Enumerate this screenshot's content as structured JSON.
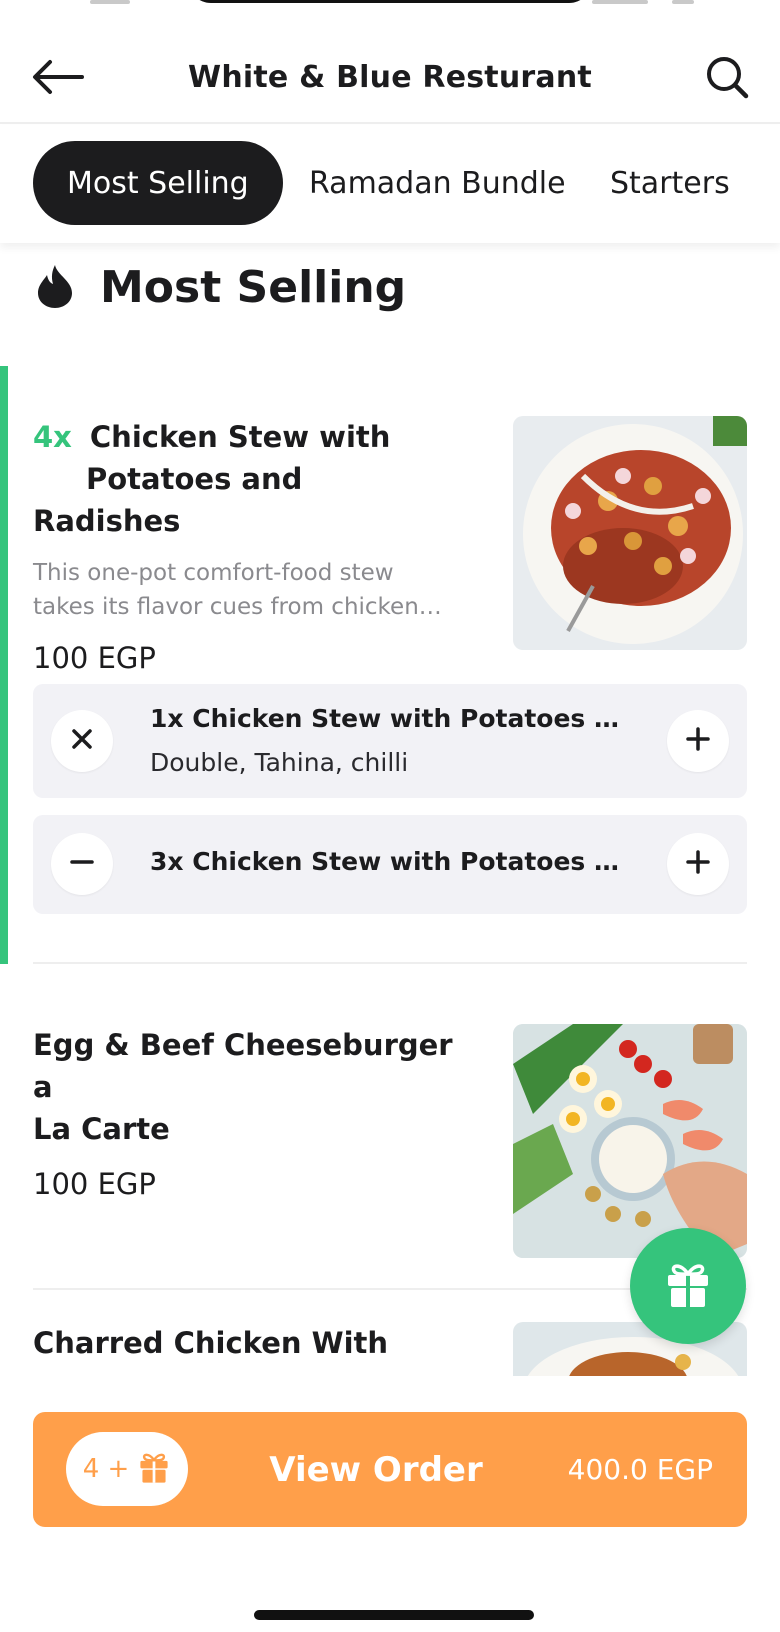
{
  "header": {
    "title": "White & Blue Resturant",
    "back_icon": "arrow-left-icon",
    "search_icon": "search-icon"
  },
  "tabs": [
    {
      "label": "Most Selling",
      "active": true
    },
    {
      "label": "Ramadan Bundle",
      "active": false
    },
    {
      "label": "Starters",
      "active": false
    }
  ],
  "section": {
    "title": "Most Selling",
    "icon": "flame-icon"
  },
  "items": [
    {
      "qty": "4x",
      "name_line1": "Chicken Stew with",
      "name_line2": "Potatoes and Radishes",
      "desc_line1": "This one-pot comfort-food stew",
      "desc_line2": "takes its flavor cues from chicken…",
      "price": "100 EGP",
      "selections": [
        {
          "title": "1x Chicken Stew with Potatoes a…",
          "extras": "Double, Tahina, chilli",
          "left_icon": "close-icon",
          "right_icon": "plus-icon"
        },
        {
          "title": "3x Chicken Stew with Potatoes a…",
          "left_icon": "minus-icon",
          "right_icon": "plus-icon"
        }
      ]
    },
    {
      "name_line1": "Egg & Beef Cheeseburger a",
      "name_line2": "La Carte",
      "price": "100 EGP"
    },
    {
      "name_line1": "Charred Chicken With"
    }
  ],
  "order_bar": {
    "gift_count": "4 +",
    "label": "View Order",
    "total": "400.0 EGP"
  },
  "colors": {
    "accent_green": "#35c47c",
    "order_orange": "#ff9f4a",
    "dark": "#1c1c1e"
  }
}
